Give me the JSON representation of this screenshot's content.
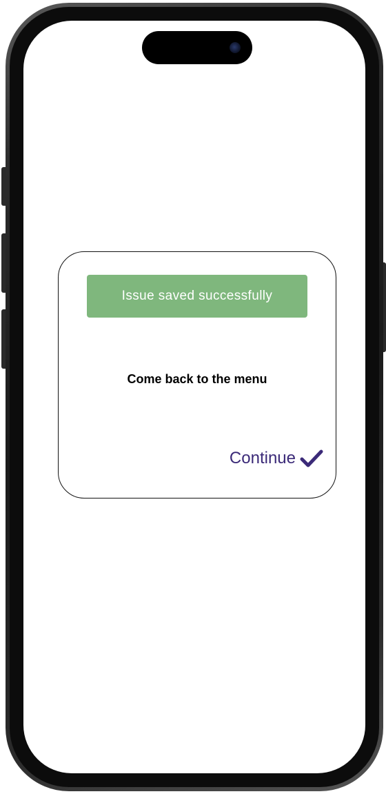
{
  "dialog": {
    "toast_text": "Issue saved successfully",
    "message": "Come back to the menu",
    "continue_label": "Continue",
    "continue_icon": "checkmark-icon"
  },
  "colors": {
    "toast_background": "#7fb77d",
    "accent": "#3b2a78",
    "screen_background": "#ffffff"
  }
}
